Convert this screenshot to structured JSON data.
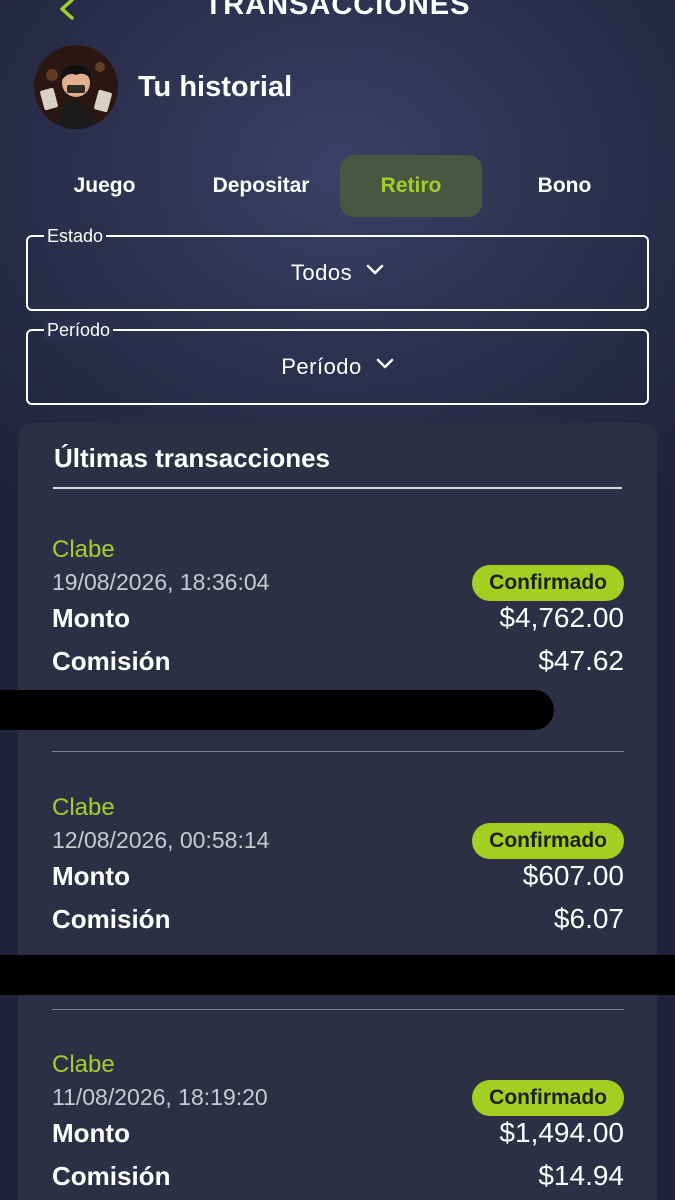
{
  "header": {
    "title": "TRANSACCIONES",
    "back_icon": "chevron-left-icon",
    "accent": "#9fd02a"
  },
  "profile": {
    "name": "Tu historial",
    "avatar_icon": "avatar"
  },
  "tabs": [
    {
      "label": "Juego",
      "active": false
    },
    {
      "label": "Depositar",
      "active": false
    },
    {
      "label": "Retiro",
      "active": true
    },
    {
      "label": "Bono",
      "active": false
    }
  ],
  "filters": {
    "estado": {
      "legend": "Estado",
      "value": "Todos",
      "icon": "chevron-down-icon"
    },
    "periodo": {
      "legend": "Período",
      "value": "Período",
      "icon": "chevron-down-icon"
    }
  },
  "transactions_panel": {
    "title": "Últimas transacciones",
    "items": [
      {
        "method": "Clabe",
        "datetime": "19/08/2026, 18:36:04",
        "status": "Confirmado",
        "amount_label": "Monto",
        "amount": "$4,762.00",
        "fee_label": "Comisión",
        "fee": "$47.62"
      },
      {
        "method": "Clabe",
        "datetime": "12/08/2026, 00:58:14",
        "status": "Confirmado",
        "amount_label": "Monto",
        "amount": "$607.00",
        "fee_label": "Comisión",
        "fee": "$6.07"
      },
      {
        "method": "Clabe",
        "datetime": "11/08/2026, 18:19:20",
        "status": "Confirmado",
        "amount_label": "Monto",
        "amount": "$1,494.00",
        "fee_label": "Comisión",
        "fee": "$14.94"
      }
    ]
  },
  "colors": {
    "status_badge": "#a3cf22",
    "method_text": "#a6cd2c",
    "active_tab_bg": "#4a5641",
    "panel_bg": "#2d3045"
  }
}
